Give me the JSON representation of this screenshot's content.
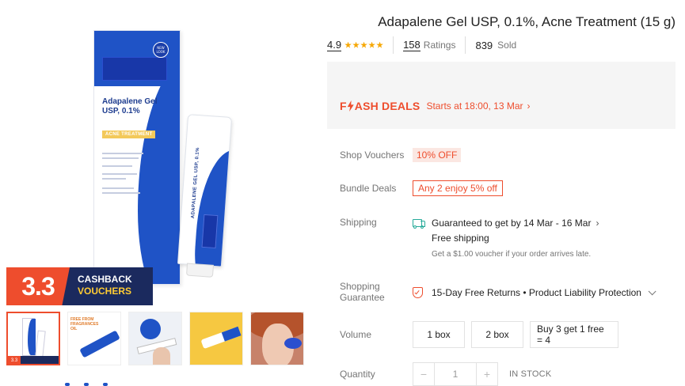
{
  "product": {
    "title": "Adapalene Gel USP, 0.1%, Acne Treatment (15 g)",
    "rating": "4.9",
    "ratings_count": "158",
    "ratings_label": "Ratings",
    "sold_count": "839",
    "sold_label": "Sold"
  },
  "media": {
    "box_badge": "NEW LOOK",
    "box_title": "Adapalene Gel USP, 0.1%",
    "box_tag": "ACNE TREATMENT",
    "tube_text": "ADAPALENE GEL USP, 0.1%",
    "cashback_number": "3.3",
    "cashback_line1": "CASHBACK",
    "cashback_line2": "VOUCHERS",
    "thumbnail_count": 5
  },
  "flash_deals": {
    "logo_part1": "F",
    "logo_part2": "ASH DEALS",
    "starts_text": "Starts at 18:00, 13 Mar",
    "accent_color": "#ee4d2d"
  },
  "shop_vouchers": {
    "label": "Shop Vouchers",
    "value": "10% OFF"
  },
  "bundle_deals": {
    "label": "Bundle Deals",
    "value": "Any 2 enjoy 5% off"
  },
  "shipping": {
    "label": "Shipping",
    "guarantee": "Guaranteed to get by 14 Mar - 16 Mar",
    "free_shipping": "Free shipping",
    "note": "Get a $1.00 voucher if your order arrives late.",
    "icon": "truck-icon",
    "icon_color": "#26aa99"
  },
  "guarantee": {
    "label_line1": "Shopping",
    "label_line2": "Guarantee",
    "text": "15-Day Free Returns • Product Liability Protection"
  },
  "volume": {
    "label": "Volume",
    "options": [
      "1 box",
      "2 box",
      "Buy 3 get 1 free = 4"
    ]
  },
  "quantity": {
    "label": "Quantity",
    "minus": "−",
    "value": "1",
    "plus": "+",
    "stock": "IN STOCK"
  }
}
